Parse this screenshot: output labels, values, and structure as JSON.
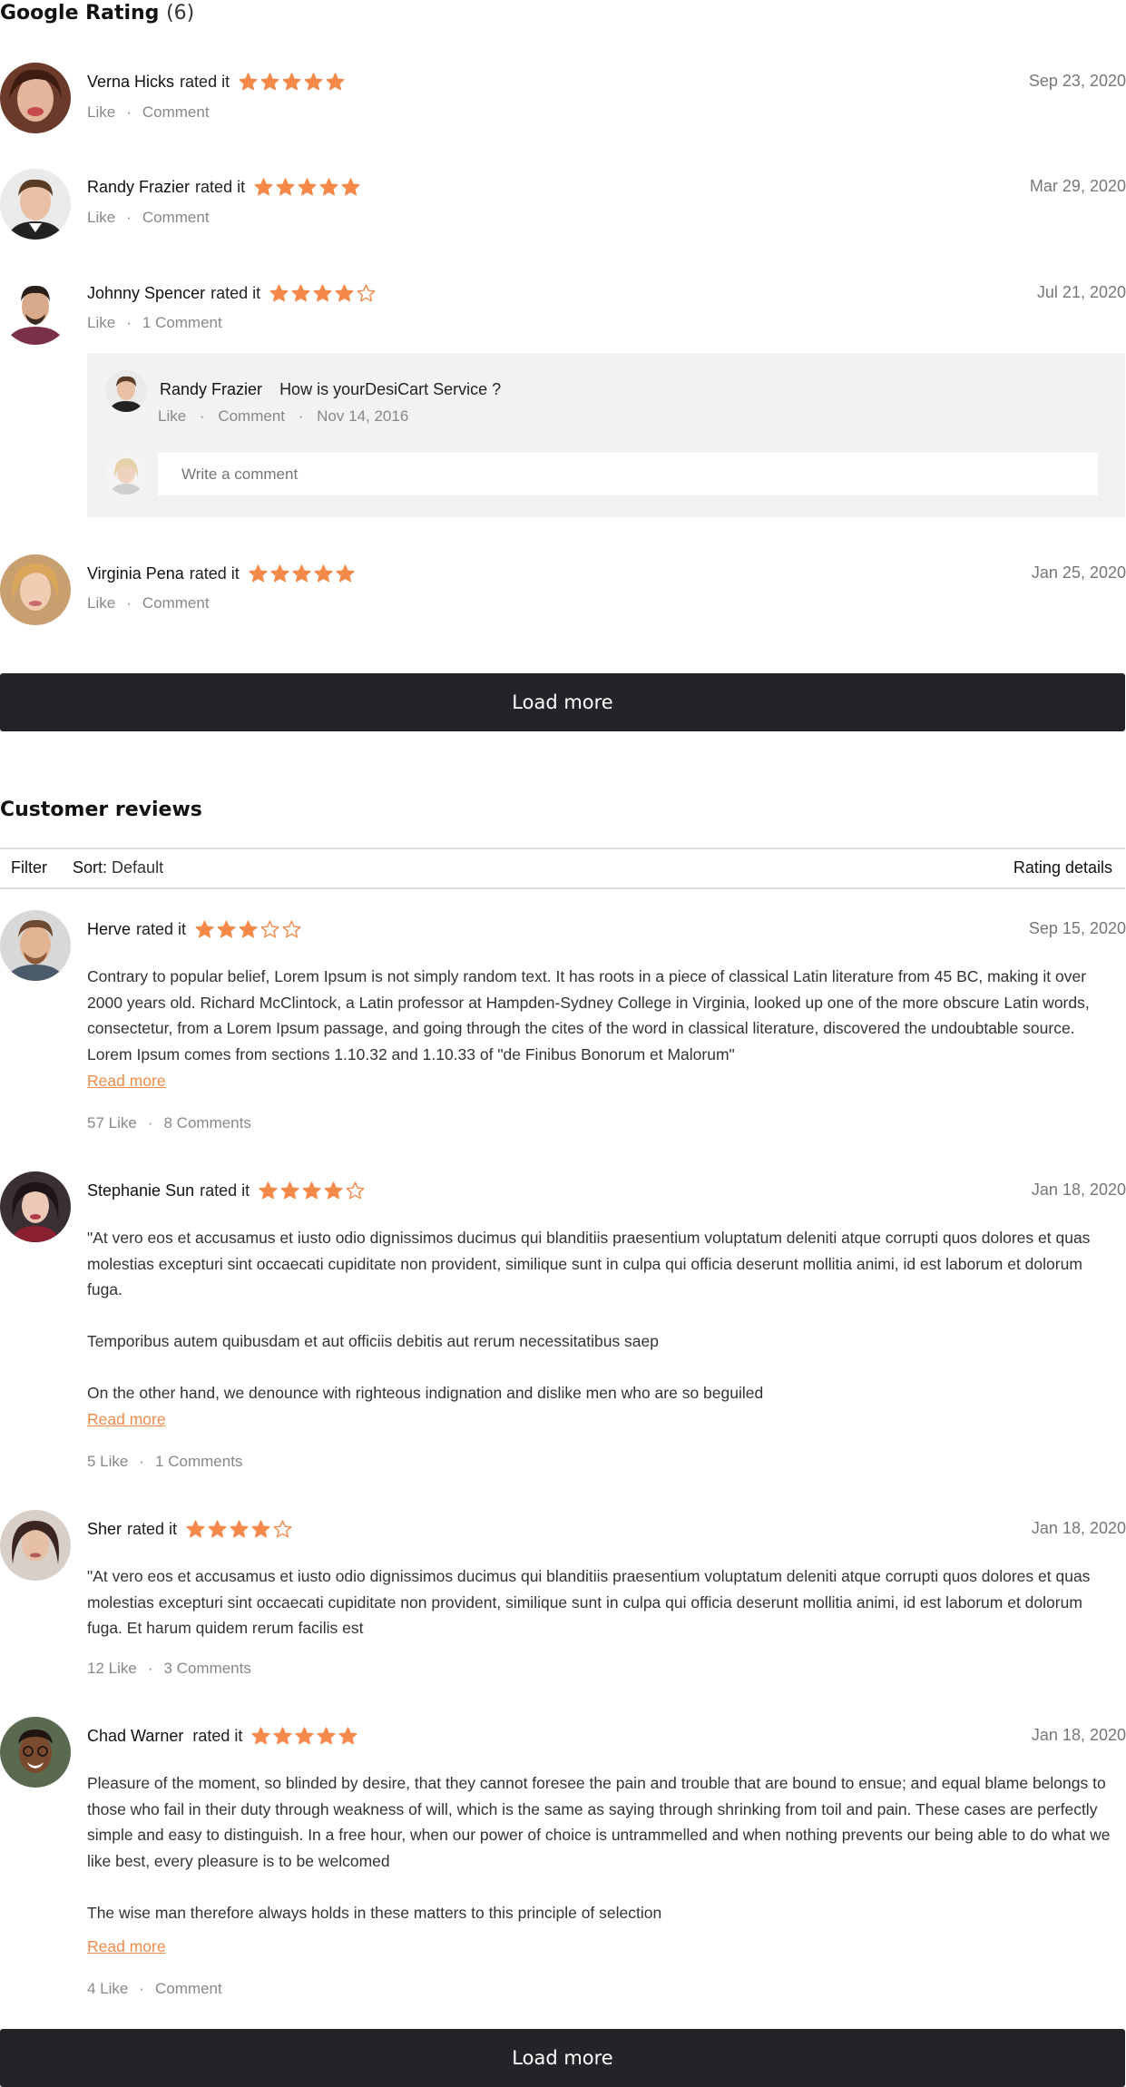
{
  "google_rating": {
    "title": "Google Rating",
    "count": "(6)",
    "items": [
      {
        "name": "Verna Hicks",
        "rated": "rated it",
        "stars": 5,
        "date": "Sep 23, 2020",
        "like": "Like",
        "comment": "Comment"
      },
      {
        "name": "Randy Frazier",
        "rated": "rated it",
        "stars": 5,
        "date": "Mar 29, 2020",
        "like": "Like",
        "comment": "Comment"
      },
      {
        "name": "Johnny Spencer",
        "rated": "rated it",
        "stars": 4,
        "date": "Jul 21, 2020",
        "like": "Like",
        "comment": "1 Comment"
      },
      {
        "name": "Virginia Pena",
        "rated": "rated it",
        "stars": 5,
        "date": "Jan 25, 2020",
        "like": "Like",
        "comment": "Comment"
      }
    ],
    "reply": {
      "name": "Randy Frazier",
      "text": "How is yourDesiCart Service ?",
      "like": "Like",
      "comment": "Comment",
      "date": "Nov 14, 2016",
      "input_placeholder": "Write a comment"
    },
    "load_more": "Load more"
  },
  "customer_reviews": {
    "title": "Customer reviews",
    "filter_label": "Filter",
    "sort_label": "Sort:",
    "sort_value": "Default",
    "rating_details": "Rating details",
    "items": [
      {
        "name": "Herve",
        "rated": "rated it",
        "stars": 3,
        "date": "Sep 15, 2020",
        "paragraphs": [
          "Contrary to popular belief, Lorem Ipsum is not simply random text. It has roots in a piece of classical Latin literature from 45 BC, making it over 2000 years old. Richard McClintock, a Latin professor at Hampden-Sydney College in Virginia, looked up one of the more obscure Latin words, consectetur, from a Lorem Ipsum passage, and going through the cites of the word in classical literature, discovered the undoubtable source. Lorem Ipsum comes from sections 1.10.32 and 1.10.33 of \"de Finibus Bonorum et Malorum\""
        ],
        "read_more": "Read more",
        "likes": "57 Like",
        "comments": "8 Comments"
      },
      {
        "name": "Stephanie Sun",
        "rated": "rated it",
        "stars": 4,
        "date": "Jan 18, 2020",
        "paragraphs": [
          "\"At vero eos et accusamus et iusto odio dignissimos ducimus qui blanditiis praesentium voluptatum deleniti atque corrupti quos dolores et quas molestias excepturi sint occaecati cupiditate non provident, similique sunt in culpa qui officia deserunt mollitia animi, id est laborum et dolorum fuga.",
          "Temporibus autem quibusdam et aut officiis debitis aut rerum necessitatibus saep",
          "On the other hand, we denounce with righteous indignation and dislike men who are so beguiled"
        ],
        "read_more": "Read more",
        "likes": "5 Like",
        "comments": "1 Comments"
      },
      {
        "name": "Sher",
        "rated": "rated it",
        "stars": 4,
        "date": "Jan 18, 2020",
        "paragraphs": [
          "\"At vero eos et accusamus et iusto odio dignissimos ducimus qui blanditiis praesentium voluptatum deleniti atque corrupti quos dolores et quas molestias excepturi sint occaecati cupiditate non provident, similique sunt in culpa qui officia deserunt mollitia animi, id est laborum et dolorum fuga. Et harum quidem rerum facilis est"
        ],
        "read_more": "",
        "likes": "12 Like",
        "comments": "3 Comments"
      },
      {
        "name": "Chad Warner",
        "rated": "rated it",
        "stars": 5,
        "date": "Jan 18, 2020",
        "paragraphs": [
          "Pleasure of the moment, so blinded by desire, that they cannot foresee the pain and trouble that are bound to ensue; and equal blame belongs to those who fail in their duty through weakness of will, which is the same as saying through shrinking from toil and pain. These cases are perfectly simple and easy to distinguish. In a free hour, when our power of choice is untrammelled and when nothing prevents our being able to do what we like best, every pleasure is to be welcomed",
          "The wise man therefore always holds in these matters to this principle of selection"
        ],
        "read_more": "Read more",
        "likes": "4 Like",
        "comments": "Comment"
      }
    ],
    "load_more": "Load more"
  },
  "colors": {
    "star": "#f5894a",
    "button": "#232428",
    "link": "#f08b4a"
  }
}
